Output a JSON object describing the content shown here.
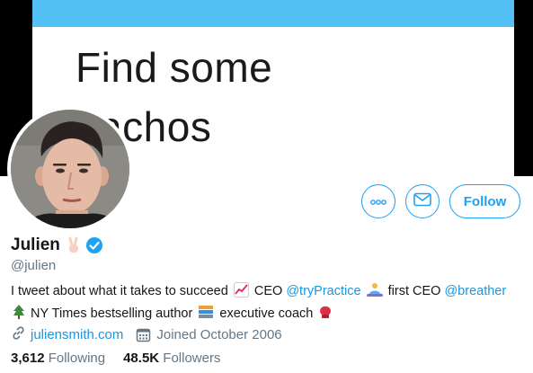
{
  "banner": {
    "lines": [
      "Find some",
      "nachos",
      "..."
    ]
  },
  "profile": {
    "name": "Julien",
    "handle": "@julien",
    "bio": {
      "part1": "I tweet about what it takes to succeed",
      "ceo_label": "CEO",
      "mention1": "@tryPractice",
      "first_ceo_label": "first CEO",
      "mention2": "@breather",
      "part2": "NY Times bestselling author",
      "part3": "executive coach"
    },
    "website": "juliensmith.com",
    "joined": "Joined October 2006",
    "following_count": "3,612",
    "following_label": "Following",
    "followers_count": "48.5K",
    "followers_label": "Followers"
  },
  "actions": {
    "follow_label": "Follow"
  },
  "colors": {
    "accent": "#1da1f2",
    "link": "#1b95e0",
    "banner_bar": "#54c1f4"
  }
}
